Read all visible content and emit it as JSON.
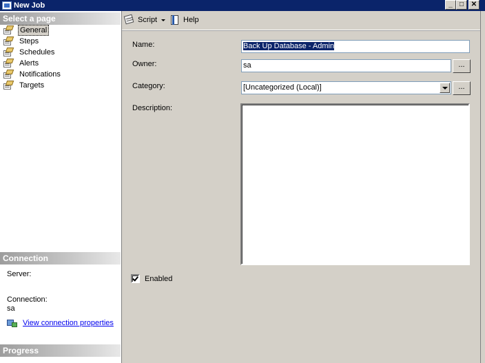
{
  "window": {
    "title": "New Job"
  },
  "left": {
    "select_header": "Select a page",
    "pages": [
      {
        "label": "General"
      },
      {
        "label": "Steps"
      },
      {
        "label": "Schedules"
      },
      {
        "label": "Alerts"
      },
      {
        "label": "Notifications"
      },
      {
        "label": "Targets"
      }
    ],
    "connection_header": "Connection",
    "server_label": "Server:",
    "connection_label": "Connection:",
    "connection_value": "sa",
    "view_conn_link": "View connection properties",
    "progress_header": "Progress"
  },
  "toolbar": {
    "script": "Script",
    "help": "Help"
  },
  "form": {
    "name_label": "Name:",
    "name_value": "Back Up Database - Admin",
    "owner_label": "Owner:",
    "owner_value": "sa",
    "category_label": "Category:",
    "category_value": "[Uncategorized (Local)]",
    "browse": "...",
    "description_label": "Description:",
    "enabled_label": "Enabled",
    "enabled_checked": true
  }
}
